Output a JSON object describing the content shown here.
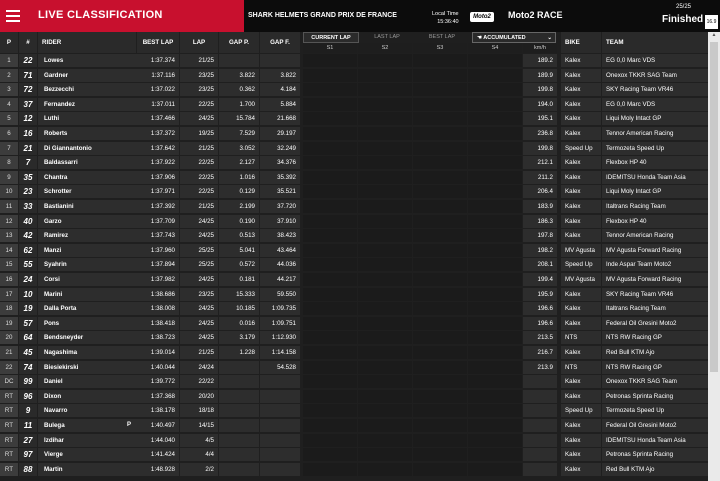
{
  "header": {
    "title": "LIVE CLASSIFICATION",
    "event": "SHARK HELMETS GRAND PRIX DE FRANCE",
    "local_time_label": "Local Time",
    "local_time": "15:36:40",
    "series_logo_text": "Moto2",
    "race": "Moto2 RACE",
    "lap_count": "25/25",
    "status": "Finished",
    "flag_text": "16.9"
  },
  "columns": {
    "pos": "P",
    "num": "#",
    "rider": "RIDER",
    "best_lap": "BEST LAP",
    "lap": "LAP",
    "gap_p": "GAP P.",
    "gap_f": "GAP F.",
    "bike": "BIKE",
    "team": "TEAM",
    "speed": "km/h"
  },
  "tabs": {
    "current_lap": "CURRENT LAP",
    "last_lap": "LAST LAP",
    "best_lap": "BEST LAP",
    "accumulated": "ACCUMULATED",
    "sectors": [
      "S1",
      "S2",
      "S3",
      "S4"
    ]
  },
  "rows": [
    {
      "pos": "1",
      "num": "22",
      "rider": "Lowes",
      "best": "1:37.374",
      "lap": "21/25",
      "gap_p": "",
      "gap_f": "",
      "speed": "189.2",
      "bike": "Kalex",
      "team": "EG 0,0 Marc VDS"
    },
    {
      "pos": "2",
      "num": "71",
      "rider": "Gardner",
      "best": "1:37.116",
      "lap": "23/25",
      "gap_p": "3.822",
      "gap_f": "3.822",
      "speed": "189.9",
      "bike": "Kalex",
      "team": "Onexox TKKR SAG Team"
    },
    {
      "pos": "3",
      "num": "72",
      "rider": "Bezzecchi",
      "best": "1:37.022",
      "lap": "23/25",
      "gap_p": "0.362",
      "gap_f": "4.184",
      "speed": "199.8",
      "bike": "Kalex",
      "team": "SKY Racing Team VR46"
    },
    {
      "pos": "4",
      "num": "37",
      "rider": "Fernandez",
      "best": "1:37.011",
      "lap": "22/25",
      "gap_p": "1.700",
      "gap_f": "5.884",
      "speed": "194.0",
      "bike": "Kalex",
      "team": "EG 0,0 Marc VDS"
    },
    {
      "pos": "5",
      "num": "12",
      "rider": "Luthi",
      "best": "1:37.466",
      "lap": "24/25",
      "gap_p": "15.784",
      "gap_f": "21.668",
      "speed": "195.1",
      "bike": "Kalex",
      "team": "Liqui Moly Intact GP"
    },
    {
      "pos": "6",
      "num": "16",
      "rider": "Roberts",
      "best": "1:37.372",
      "lap": "19/25",
      "gap_p": "7.529",
      "gap_f": "29.197",
      "speed": "236.8",
      "bike": "Kalex",
      "team": "Tennor American Racing"
    },
    {
      "pos": "7",
      "num": "21",
      "rider": "Di Giannantonio",
      "best": "1:37.642",
      "lap": "21/25",
      "gap_p": "3.052",
      "gap_f": "32.249",
      "speed": "199.8",
      "bike": "Speed Up",
      "team": "Termozeta Speed Up"
    },
    {
      "pos": "8",
      "num": "7",
      "rider": "Baldassarri",
      "best": "1:37.922",
      "lap": "22/25",
      "gap_p": "2.127",
      "gap_f": "34.376",
      "speed": "212.1",
      "bike": "Kalex",
      "team": "Flexbox HP 40"
    },
    {
      "pos": "9",
      "num": "35",
      "rider": "Chantra",
      "best": "1:37.906",
      "lap": "22/25",
      "gap_p": "1.016",
      "gap_f": "35.392",
      "speed": "211.2",
      "bike": "Kalex",
      "team": "IDEMITSU Honda Team Asia"
    },
    {
      "pos": "10",
      "num": "23",
      "rider": "Schrotter",
      "best": "1:37.971",
      "lap": "22/25",
      "gap_p": "0.129",
      "gap_f": "35.521",
      "speed": "206.4",
      "bike": "Kalex",
      "team": "Liqui Moly Intact GP"
    },
    {
      "pos": "11",
      "num": "33",
      "rider": "Bastianini",
      "best": "1:37.392",
      "lap": "21/25",
      "gap_p": "2.199",
      "gap_f": "37.720",
      "speed": "183.9",
      "bike": "Kalex",
      "team": "Italtrans Racing Team"
    },
    {
      "pos": "12",
      "num": "40",
      "rider": "Garzo",
      "best": "1:37.709",
      "lap": "24/25",
      "gap_p": "0.190",
      "gap_f": "37.910",
      "speed": "186.3",
      "bike": "Kalex",
      "team": "Flexbox HP 40"
    },
    {
      "pos": "13",
      "num": "42",
      "rider": "Ramirez",
      "best": "1:37.743",
      "lap": "24/25",
      "gap_p": "0.513",
      "gap_f": "38.423",
      "speed": "197.8",
      "bike": "Kalex",
      "team": "Tennor American Racing"
    },
    {
      "pos": "14",
      "num": "62",
      "rider": "Manzi",
      "best": "1:37.960",
      "lap": "25/25",
      "gap_p": "5.041",
      "gap_f": "43.464",
      "speed": "198.2",
      "bike": "MV Agusta",
      "team": "MV Agusta Forward Racing"
    },
    {
      "pos": "15",
      "num": "55",
      "rider": "Syahrin",
      "best": "1:37.894",
      "lap": "25/25",
      "gap_p": "0.572",
      "gap_f": "44.036",
      "speed": "208.1",
      "bike": "Speed Up",
      "team": "Inde Aspar Team Moto2"
    },
    {
      "pos": "16",
      "num": "24",
      "rider": "Corsi",
      "best": "1:37.982",
      "lap": "24/25",
      "gap_p": "0.181",
      "gap_f": "44.217",
      "speed": "199.4",
      "bike": "MV Agusta",
      "team": "MV Agusta Forward Racing"
    },
    {
      "pos": "17",
      "num": "10",
      "rider": "Marini",
      "best": "1:38.686",
      "lap": "23/25",
      "gap_p": "15.333",
      "gap_f": "59.550",
      "speed": "195.9",
      "bike": "Kalex",
      "team": "SKY Racing Team VR46"
    },
    {
      "pos": "18",
      "num": "19",
      "rider": "Dalla Porta",
      "best": "1:38.008",
      "lap": "24/25",
      "gap_p": "10.185",
      "gap_f": "1:09.735",
      "speed": "196.6",
      "bike": "Kalex",
      "team": "Italtrans Racing Team"
    },
    {
      "pos": "19",
      "num": "57",
      "rider": "Pons",
      "best": "1:38.418",
      "lap": "24/25",
      "gap_p": "0.016",
      "gap_f": "1:09.751",
      "speed": "196.6",
      "bike": "Kalex",
      "team": "Federal Oil Gresini Moto2"
    },
    {
      "pos": "20",
      "num": "64",
      "rider": "Bendsneyder",
      "best": "1:38.723",
      "lap": "24/25",
      "gap_p": "3.179",
      "gap_f": "1:12.930",
      "speed": "213.5",
      "bike": "NTS",
      "team": "NTS RW Racing GP"
    },
    {
      "pos": "21",
      "num": "45",
      "rider": "Nagashima",
      "best": "1:39.014",
      "lap": "21/25",
      "gap_p": "1.228",
      "gap_f": "1:14.158",
      "speed": "216.7",
      "bike": "Kalex",
      "team": "Red Bull KTM Ajo"
    },
    {
      "pos": "22",
      "num": "74",
      "rider": "Biesiekirski",
      "best": "1:40.044",
      "lap": "24/24",
      "gap_p": "",
      "gap_f": "54.528",
      "speed": "213.9",
      "bike": "NTS",
      "team": "NTS RW Racing GP"
    },
    {
      "pos": "DC",
      "num": "99",
      "rider": "Daniel",
      "best": "1:39.772",
      "lap": "22/22",
      "gap_p": "",
      "gap_f": "",
      "speed": "",
      "bike": "Kalex",
      "team": "Onexox TKKR SAG Team"
    },
    {
      "pos": "RT",
      "num": "96",
      "rider": "Dixon",
      "best": "1:37.368",
      "lap": "20/20",
      "gap_p": "",
      "gap_f": "",
      "speed": "",
      "bike": "Kalex",
      "team": "Petronas Sprinta Racing"
    },
    {
      "pos": "RT",
      "num": "9",
      "rider": "Navarro",
      "best": "1:38.178",
      "lap": "18/18",
      "gap_p": "",
      "gap_f": "",
      "speed": "",
      "bike": "Speed Up",
      "team": "Termozeta Speed Up"
    },
    {
      "pos": "RT",
      "num": "11",
      "rider": "Bulega",
      "best": "1:40.497",
      "lap": "14/15",
      "gap_p": "",
      "gap_f": "",
      "speed": "",
      "bike": "Kalex",
      "team": "Federal Oil Gresini Moto2",
      "penalty": "P"
    },
    {
      "pos": "RT",
      "num": "27",
      "rider": "Izdihar",
      "best": "1:44.040",
      "lap": "4/5",
      "gap_p": "",
      "gap_f": "",
      "speed": "",
      "bike": "Kalex",
      "team": "IDEMITSU Honda Team Asia"
    },
    {
      "pos": "RT",
      "num": "97",
      "rider": "Vierge",
      "best": "1:41.424",
      "lap": "4/4",
      "gap_p": "",
      "gap_f": "",
      "speed": "",
      "bike": "Kalex",
      "team": "Petronas Sprinta Racing"
    },
    {
      "pos": "RT",
      "num": "88",
      "rider": "Martin",
      "best": "1:48.928",
      "lap": "2/2",
      "gap_p": "",
      "gap_f": "",
      "speed": "",
      "bike": "Kalex",
      "team": "Red Bull KTM Ajo"
    }
  ]
}
